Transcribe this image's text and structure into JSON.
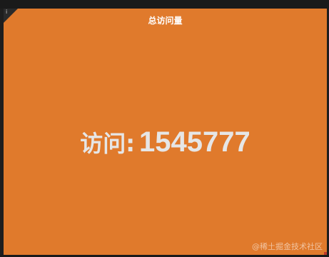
{
  "panel": {
    "title": "总访问量",
    "menu_glyph": "i",
    "background": "#e07a2c"
  },
  "stat": {
    "label": "访问:",
    "value": "1545777"
  },
  "watermark": "@稀土掘金技术社区"
}
